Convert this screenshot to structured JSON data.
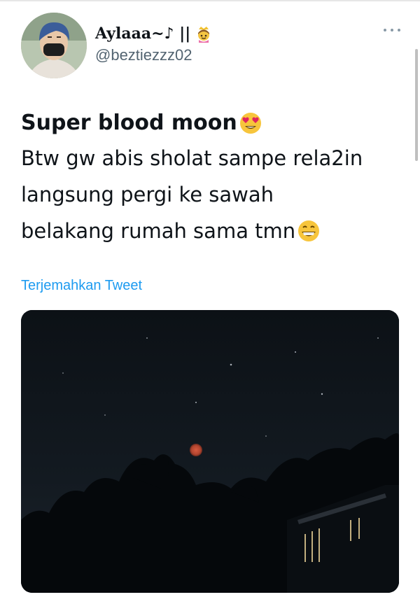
{
  "tweet": {
    "author": {
      "display_name": "Aylaaa~♪ ||",
      "handle": "@beztiezzz02",
      "avatar_icon": "user-avatar",
      "name_emoji_icon": "princess-crown-emoji"
    },
    "more_icon": "more-horizontal-icon",
    "text": {
      "headline": "Super blood moon",
      "headline_emoji": "heart-eyes-emoji",
      "line1": "Btw gw abis sholat sampe rela2in",
      "line2": "langsung pergi ke sawah",
      "line3": "belakang rumah sama tmn",
      "line3_emoji": "grinning-emoji"
    },
    "translate_link": "Terjemahkan Tweet",
    "media": {
      "type": "photo",
      "subject": "blood-moon-night-sky"
    }
  },
  "colors": {
    "link": "#1d9bf0",
    "text": "#0f1419",
    "secondary_text": "#536471",
    "moon": "#c8503a",
    "sky": "#0e1318"
  }
}
